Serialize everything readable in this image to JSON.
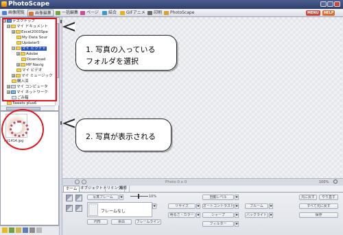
{
  "window": {
    "title": "PhotoScape"
  },
  "toolbar": {
    "tabs": [
      {
        "label": "画像閲覧",
        "active": false,
        "color": "#4f7fd6"
      },
      {
        "label": "画像編集",
        "active": true,
        "color": "#e0722b"
      },
      {
        "label": "一括編集",
        "active": false,
        "color": "#7aa33a"
      },
      {
        "label": "ページ",
        "active": false,
        "color": "#c94b9a"
      },
      {
        "label": "結合",
        "active": false,
        "color": "#3a9bc4"
      },
      {
        "label": "GIFアニメ",
        "active": false,
        "color": "#e6b21f"
      },
      {
        "label": "印刷",
        "active": false,
        "color": "#6c6c6c"
      },
      {
        "label": "PhotoScape",
        "active": false,
        "color": "#d8a430"
      }
    ],
    "badges": [
      "MENU",
      "HELP"
    ]
  },
  "folder_tree": {
    "items": [
      {
        "label": "デスクトップ",
        "expander": "⊟"
      },
      {
        "label": "マイ ドキュメント",
        "expander": "⊟"
      },
      {
        "label": "Excel2003Spe",
        "expander": "⊞"
      },
      {
        "label": "My Data Sour",
        "expander": ""
      },
      {
        "label": "Updater5",
        "expander": ""
      },
      {
        "label": "マイ ピクチャ",
        "expander": "⊟",
        "selected": true
      },
      {
        "label": "Adobe",
        "expander": "⊞"
      },
      {
        "label": "Download",
        "expander": ""
      },
      {
        "label": "MP Navig",
        "expander": "⊞"
      },
      {
        "label": "マイ ビデオ",
        "expander": ""
      },
      {
        "label": "マイ ミュージック",
        "expander": "⊞"
      },
      {
        "label": "購入済",
        "expander": ""
      },
      {
        "label": "マイ コンピュータ",
        "expander": "⊞"
      },
      {
        "label": "マイ ネットワーク",
        "expander": "⊞"
      },
      {
        "label": "ごみ箱",
        "expander": ""
      },
      {
        "label": "Tweets plus6",
        "expander": ""
      }
    ]
  },
  "thumbnails": [
    {
      "caption": "mj1414.jpg"
    }
  ],
  "callouts": [
    {
      "line1": "1. 写真の入っている",
      "line2": "フォルダを選択"
    },
    {
      "line1": "2. 写真が表示される",
      "line2": ""
    }
  ],
  "status": {
    "photo_info": "Photo 0 x 0",
    "zoom": "100%"
  },
  "edit_tabs": [
    {
      "label": "ホーム",
      "active": true
    },
    {
      "label": "オブジェクト",
      "active": false
    },
    {
      "label": "トリミング",
      "active": false
    },
    {
      "label": "補修",
      "active": false
    }
  ],
  "edit_panel": {
    "frame_label": "フレームなし",
    "frame_button": "写真フレーム",
    "frame_size": "10%",
    "round": "円形",
    "margin": "余白",
    "frame_line": "フレームライン",
    "resize": "リサイズ",
    "brightness": "明るさ・カラー",
    "filter": "フィルター",
    "auto_level": "自動レベル",
    "auto_contrast": "オートコントラスト",
    "sharpen": "シャープ",
    "bloom": "ブルーム",
    "backlight": "バックライト",
    "restore": "元に戻す",
    "redo": "やり直す",
    "undo_all": "すべて元に戻す",
    "save": "保存"
  }
}
